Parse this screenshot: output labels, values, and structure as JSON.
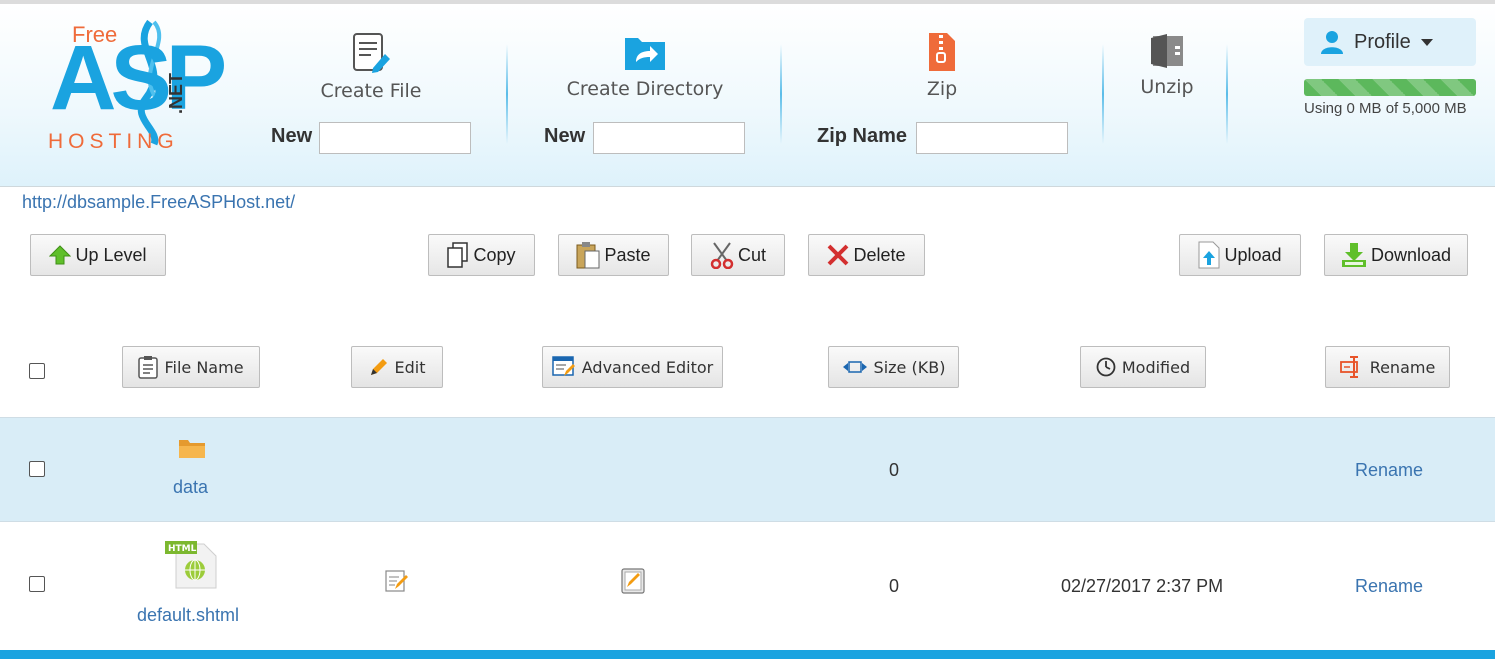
{
  "logo": {
    "free": "Free",
    "asp": "ASP",
    "hosting": "HOSTING",
    "net": ".NET"
  },
  "toolbar_top": {
    "create_file": {
      "label": "Create File",
      "field_label": "New",
      "value": ""
    },
    "create_directory": {
      "label": "Create Directory",
      "field_label": "New",
      "value": ""
    },
    "zip": {
      "label": "Zip",
      "field_label": "Zip Name",
      "value": ""
    },
    "unzip": {
      "label": "Unzip"
    }
  },
  "profile": {
    "label": "Profile",
    "usage_text": "Using 0 MB of 5,000 MB",
    "usage_fraction": 1.0
  },
  "site_url": "http://dbsample.FreeASPHost.net/",
  "actions": {
    "up_level": "Up Level",
    "copy": "Copy",
    "paste": "Paste",
    "cut": "Cut",
    "delete": "Delete",
    "upload": "Upload",
    "download": "Download"
  },
  "columns": {
    "file_name": "File Name",
    "edit": "Edit",
    "advanced_editor": "Advanced Editor",
    "size": "Size (KB)",
    "modified": "Modified",
    "rename": "Rename"
  },
  "rows": [
    {
      "name": "data",
      "type": "folder",
      "size": "0",
      "modified": "",
      "rename": "Rename"
    },
    {
      "name": "default.shtml",
      "type": "html-file",
      "size": "0",
      "modified": "02/27/2017 2:37 PM",
      "rename": "Rename"
    }
  ],
  "colors": {
    "accent": "#1aa3e0",
    "logo_orange": "#ef6b3a",
    "link": "#3a74b0",
    "row_highlight": "#d9edf7",
    "usage_green": "#5cb85c"
  }
}
